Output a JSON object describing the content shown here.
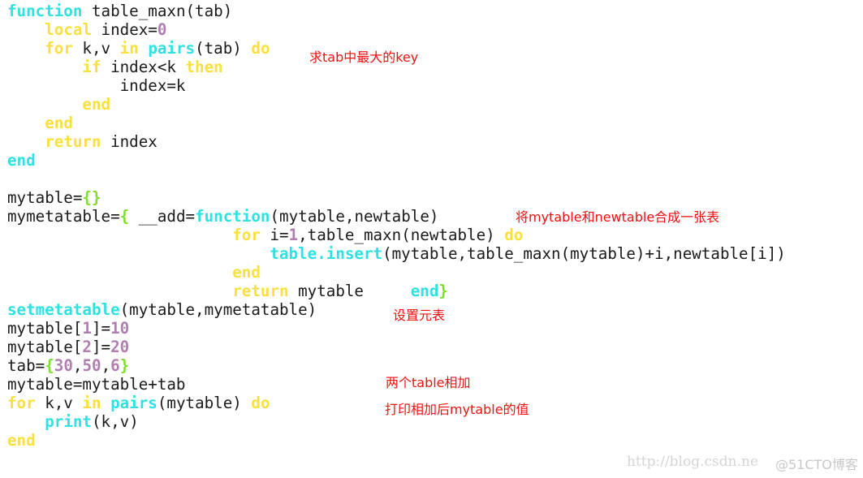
{
  "code": {
    "lines": [
      [
        {
          "t": "function",
          "c": "kw-cyan"
        },
        {
          "t": " table_maxn(tab)"
        }
      ],
      [
        {
          "t": "    "
        },
        {
          "t": "local",
          "c": "kw-yellow"
        },
        {
          "t": " index="
        },
        {
          "t": "0",
          "c": "num"
        }
      ],
      [
        {
          "t": "    "
        },
        {
          "t": "for",
          "c": "kw-yellow"
        },
        {
          "t": " k,v "
        },
        {
          "t": "in",
          "c": "kw-yellow"
        },
        {
          "t": " "
        },
        {
          "t": "pairs",
          "c": "kw-cyan"
        },
        {
          "t": "(tab) "
        },
        {
          "t": "do",
          "c": "kw-yellow"
        }
      ],
      [
        {
          "t": "        "
        },
        {
          "t": "if",
          "c": "kw-yellow"
        },
        {
          "t": " index<k "
        },
        {
          "t": "then",
          "c": "kw-yellow"
        }
      ],
      [
        {
          "t": "            index=k"
        }
      ],
      [
        {
          "t": "        "
        },
        {
          "t": "end",
          "c": "kw-yellow"
        }
      ],
      [
        {
          "t": "    "
        },
        {
          "t": "end",
          "c": "kw-yellow"
        }
      ],
      [
        {
          "t": "    "
        },
        {
          "t": "return",
          "c": "kw-yellow"
        },
        {
          "t": " index"
        }
      ],
      [
        {
          "t": "end",
          "c": "kw-cyan"
        }
      ],
      [
        {
          "t": ""
        }
      ],
      [
        {
          "t": "mytable="
        },
        {
          "t": "{}",
          "c": "brace"
        }
      ],
      [
        {
          "t": "mymetatable="
        },
        {
          "t": "{",
          "c": "brace"
        },
        {
          "t": " __add="
        },
        {
          "t": "function",
          "c": "kw-cyan"
        },
        {
          "t": "(mytable,newtable)"
        }
      ],
      [
        {
          "t": "                        "
        },
        {
          "t": "for",
          "c": "kw-yellow"
        },
        {
          "t": " i="
        },
        {
          "t": "1",
          "c": "num"
        },
        {
          "t": ",table_maxn(newtable) "
        },
        {
          "t": "do",
          "c": "kw-yellow"
        }
      ],
      [
        {
          "t": "                            "
        },
        {
          "t": "table.insert",
          "c": "kw-cyan"
        },
        {
          "t": "(mytable,table_maxn(mytable)+i,newtable[i])"
        }
      ],
      [
        {
          "t": "                        "
        },
        {
          "t": "end",
          "c": "kw-yellow"
        }
      ],
      [
        {
          "t": "                        "
        },
        {
          "t": "return",
          "c": "kw-yellow"
        },
        {
          "t": " mytable     "
        },
        {
          "t": "end",
          "c": "kw-cyan"
        },
        {
          "t": "}",
          "c": "brace"
        }
      ],
      [
        {
          "t": "setmetatable",
          "c": "kw-cyan"
        },
        {
          "t": "(mytable,mymetatable)"
        }
      ],
      [
        {
          "t": "mytable["
        },
        {
          "t": "1",
          "c": "num"
        },
        {
          "t": "]="
        },
        {
          "t": "10",
          "c": "num"
        }
      ],
      [
        {
          "t": "mytable["
        },
        {
          "t": "2",
          "c": "num"
        },
        {
          "t": "]="
        },
        {
          "t": "20",
          "c": "num"
        }
      ],
      [
        {
          "t": "tab="
        },
        {
          "t": "{",
          "c": "brace"
        },
        {
          "t": "30",
          "c": "num"
        },
        {
          "t": ","
        },
        {
          "t": "50",
          "c": "num"
        },
        {
          "t": ","
        },
        {
          "t": "6",
          "c": "num"
        },
        {
          "t": "}",
          "c": "brace"
        }
      ],
      [
        {
          "t": "mytable=mytable+tab"
        }
      ],
      [
        {
          "t": "for",
          "c": "kw-yellow"
        },
        {
          "t": " k,v "
        },
        {
          "t": "in",
          "c": "kw-yellow"
        },
        {
          "t": " "
        },
        {
          "t": "pairs",
          "c": "kw-cyan"
        },
        {
          "t": "(mytable) "
        },
        {
          "t": "do",
          "c": "kw-yellow"
        }
      ],
      [
        {
          "t": "    "
        },
        {
          "t": "print",
          "c": "kw-cyan"
        },
        {
          "t": "(k,v)"
        }
      ],
      [
        {
          "t": "end",
          "c": "kw-yellow"
        }
      ]
    ]
  },
  "annotations": {
    "max_key": "求tab中最大的key",
    "merge": "将mytable和newtable合成一张表",
    "set_meta": "设置元表",
    "add_tables": "两个table相加",
    "print_values": "打印相加后mytable的值"
  },
  "watermark": {
    "url": "http://blog.csdn.ne",
    "site": "@51CTO博客"
  },
  "colors": {
    "keyword_cyan": "#2fe1e1",
    "keyword_yellow": "#f8e040",
    "number": "#b07fb0",
    "brace": "#7ede2a",
    "annotation": "#ee1111"
  }
}
